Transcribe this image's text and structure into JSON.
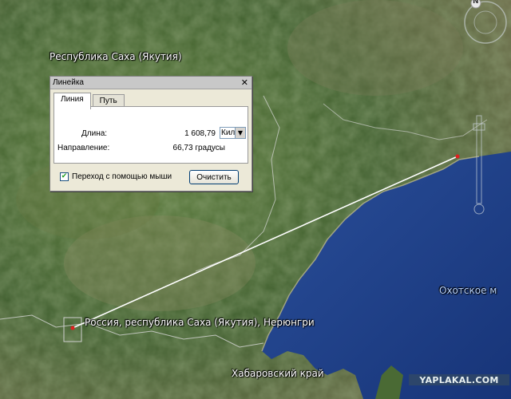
{
  "map": {
    "labels": {
      "region_top": "Республика Саха (Якутия)",
      "point_label": "Россия, республика Саха (Якутия), Нерюнгри",
      "region_bottom": "Хабаровский край",
      "sea": "Охотское м"
    },
    "colors": {
      "measure_line": "#ffffff",
      "marker": "#e02020",
      "sea": "#1e3f8a",
      "land": "#3d5a2c"
    }
  },
  "ruler": {
    "title": "Линейка",
    "close_icon": "close-icon",
    "tabs": [
      {
        "label": "Линия",
        "active": true
      },
      {
        "label": "Путь",
        "active": false
      }
    ],
    "length_label": "Длина:",
    "length_value": "1 608,79",
    "unit_selected": "Километры",
    "direction_label": "Направление:",
    "direction_value": "66,73 градусы",
    "mouse_nav_label": "Переход с помощью мыши",
    "mouse_nav_checked": true,
    "clear_label": "Очистить"
  },
  "nav": {
    "north_letter": "N"
  },
  "watermark": "YAPLAKAL.COM"
}
